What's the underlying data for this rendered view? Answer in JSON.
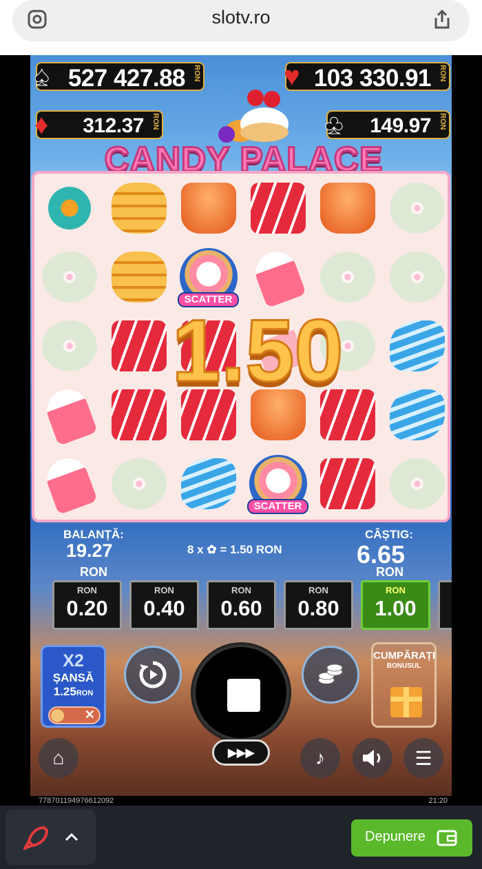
{
  "browser": {
    "url": "slotv.ro"
  },
  "jackpots": [
    {
      "suit": "♠",
      "value": "527 427.88",
      "currency": "RON"
    },
    {
      "suit": "♥",
      "value": "103 330.91",
      "currency": "RON"
    },
    {
      "suit": "♦",
      "value": "312.37",
      "currency": "RON"
    },
    {
      "suit": "♣",
      "value": "149.97",
      "currency": "RON"
    }
  ],
  "game": {
    "title": "CANDY PALACE",
    "scatter_label": "SCATTER",
    "win_overlay": "1.50"
  },
  "info": {
    "balance_label": "BALANȚĂ:",
    "balance_value": "19.27",
    "balance_currency": "RON",
    "win_line_text": "8 x  ✿  = 1.50 RON",
    "win_label": "CÂȘTIG:",
    "win_value": "6.65",
    "win_currency": "RON"
  },
  "bets": [
    {
      "currency": "RON",
      "value": "0.20",
      "selected": false
    },
    {
      "currency": "RON",
      "value": "0.40",
      "selected": false
    },
    {
      "currency": "RON",
      "value": "0.60",
      "selected": false
    },
    {
      "currency": "RON",
      "value": "0.80",
      "selected": false
    },
    {
      "currency": "RON",
      "value": "1.00",
      "selected": true
    }
  ],
  "x2_chance": {
    "title": "X2",
    "label": "ȘANSĂ",
    "price": "1.25",
    "currency": "RON"
  },
  "buy_bonus": {
    "title": "CUMPĂRAȚI",
    "subtitle": "BONUSUL"
  },
  "footer": {
    "id": "778701194976612092",
    "time": "21:20"
  },
  "bottom_bar": {
    "deposit_label": "Depunere"
  },
  "colors": {
    "accent_green": "#5ab82a",
    "jackpot_gold": "#e0b040"
  }
}
